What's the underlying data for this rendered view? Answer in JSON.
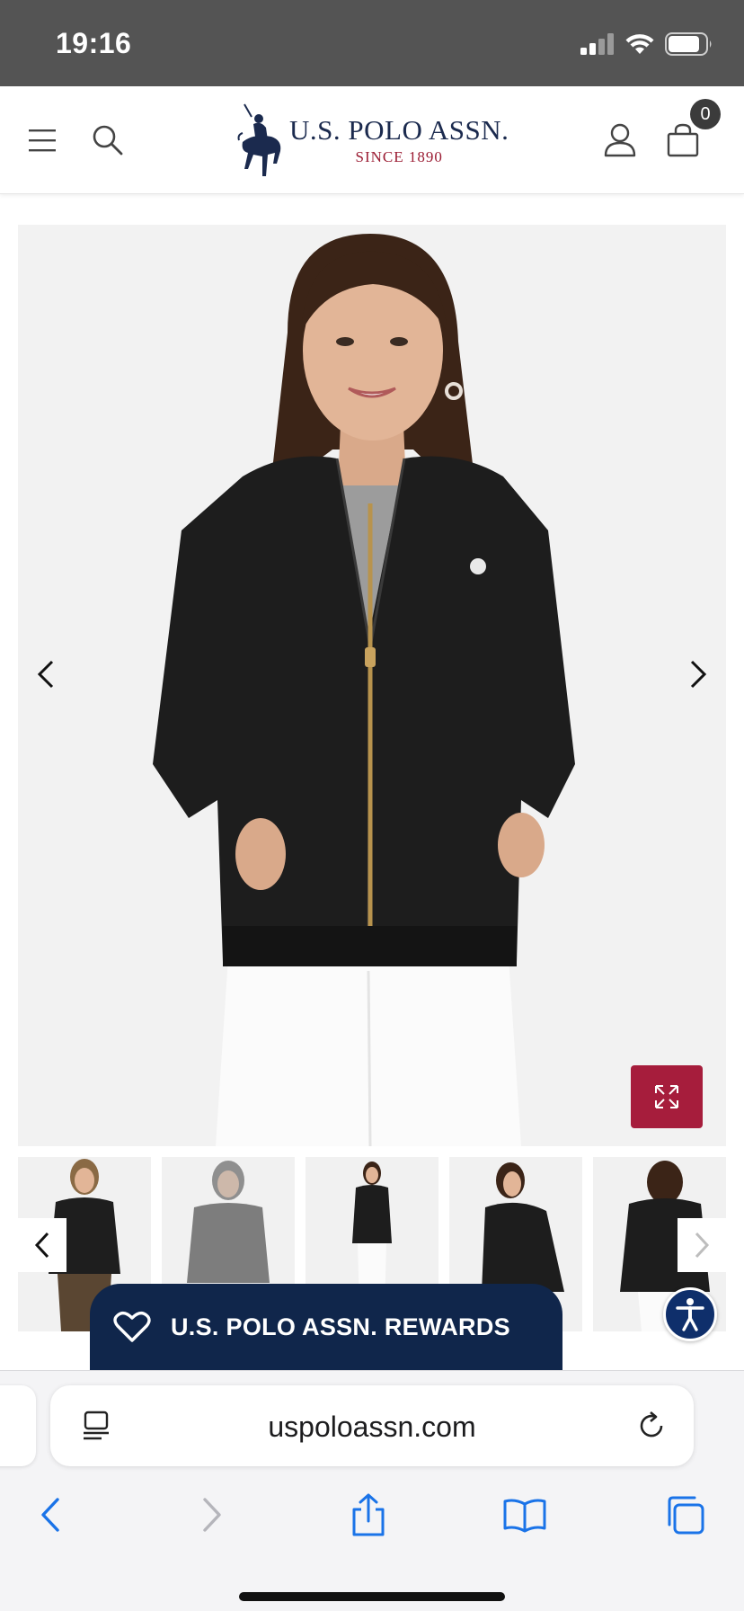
{
  "status_bar": {
    "time": "19:16",
    "icons": [
      "cellular-signal-icon",
      "wifi-icon",
      "battery-icon"
    ]
  },
  "header": {
    "menu_icon": "hamburger-menu-icon",
    "search_icon": "search-icon",
    "logo": {
      "name": "U.S. POLO ASSN.",
      "tagline": "SINCE 1890",
      "emblem_icon": "polo-player-icon"
    },
    "account_icon": "user-icon",
    "cart_icon": "shopping-bag-icon",
    "cart_count": "0"
  },
  "gallery": {
    "main_image": "woman-wearing-black-bomber-jacket",
    "prev_icon": "chevron-left-icon",
    "next_icon": "chevron-right-icon",
    "expand_icon": "expand-arrows-icon",
    "thumbnails": [
      "model-front-brown-pants",
      "model-front-faded",
      "model-full-body",
      "model-side-view",
      "model-back-view"
    ]
  },
  "accessibility_icon": "accessibility-person-icon",
  "rewards": {
    "icon": "heart-icon",
    "label": "U.S. POLO ASSN. REWARDS"
  },
  "browser": {
    "url": "uspoloassn.com",
    "page_menu_icon": "page-menu-icon",
    "reload_icon": "reload-icon",
    "toolbar": [
      "back-icon",
      "forward-icon",
      "share-icon",
      "bookmarks-icon",
      "tabs-icon"
    ]
  },
  "colors": {
    "brand_navy": "#10264b",
    "brand_red": "#a61d3c",
    "status_bar": "#545454",
    "safari_blue": "#1a73e8"
  }
}
